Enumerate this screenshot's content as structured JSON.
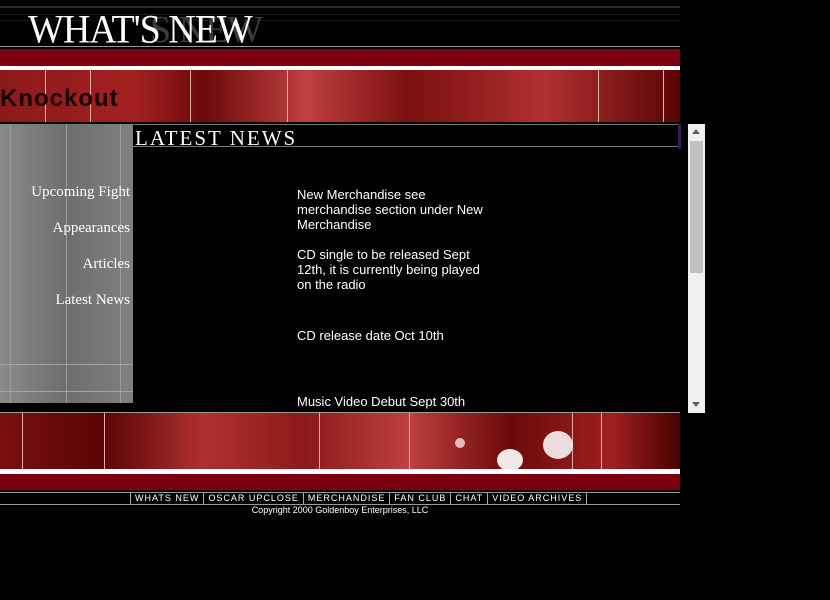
{
  "header": {
    "title": "WHAT'S NEW",
    "title_ghost": "S NEW"
  },
  "banner": {
    "knockout_text": "Knockout"
  },
  "sidebar": {
    "items": [
      {
        "label": "Upcoming Fight"
      },
      {
        "label": "Appearances"
      },
      {
        "label": "Articles"
      },
      {
        "label": "Latest News"
      }
    ]
  },
  "section": {
    "heading": "LATEST NEWS"
  },
  "news": [
    {
      "text": "New Merchandise see merchandise section under New Merchandise"
    },
    {
      "text": "CD single to be released Sept 12th, it is currently being played on the radio"
    },
    {
      "text": "CD release date Oct 10th"
    },
    {
      "text": "Music Video Debut Sept 30th"
    }
  ],
  "footer": {
    "nav": [
      {
        "label": "WHATS NEW"
      },
      {
        "label": "OSCAR UPCLOSE"
      },
      {
        "label": "MERCHANDISE"
      },
      {
        "label": "FAN CLUB"
      },
      {
        "label": "CHAT"
      },
      {
        "label": "VIDEO ARCHIVES"
      }
    ],
    "copyright": "Copyright 2000 Goldenboy Enterprises, LLC"
  },
  "colors": {
    "background": "#000000",
    "brand_red": "#7a0010",
    "sidebar_gray": "#7a7a7a"
  }
}
